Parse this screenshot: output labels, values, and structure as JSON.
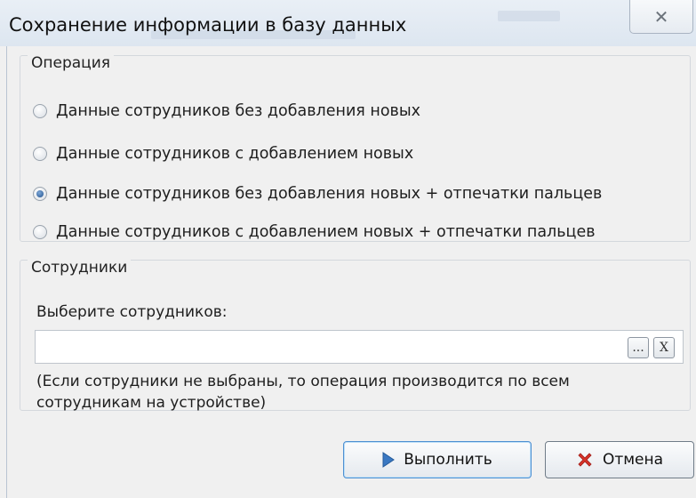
{
  "window": {
    "title": "Сохранение информации в базу данных",
    "close_glyph": "✕"
  },
  "operation_group": {
    "title": "Операция",
    "options": [
      {
        "label": "Данные сотрудников без добавления новых",
        "selected": false
      },
      {
        "label": "Данные сотрудников с добавлением новых",
        "selected": false
      },
      {
        "label": "Данные сотрудников без добавления новых + отпечатки пальцев",
        "selected": true
      },
      {
        "label": "Данные сотрудников с добавлением новых + отпечатки пальцев",
        "selected": false
      }
    ]
  },
  "employees_group": {
    "title": "Сотрудники",
    "select_label": "Выберите сотрудников:",
    "input_value": "",
    "browse_label": "...",
    "clear_label": "X",
    "note": "(Если сотрудники не выбраны, то операция производится по всем сотрудникам на устройстве)"
  },
  "buttons": {
    "run_label": "Выполнить",
    "cancel_label": "Отмена"
  },
  "icons": {
    "run": "play-icon",
    "cancel": "red-x-icon",
    "close": "close-icon"
  },
  "colors": {
    "radio_selected": "#1f4f8c",
    "run_icon": "#3a78c2",
    "cancel_icon": "#d8332a"
  }
}
